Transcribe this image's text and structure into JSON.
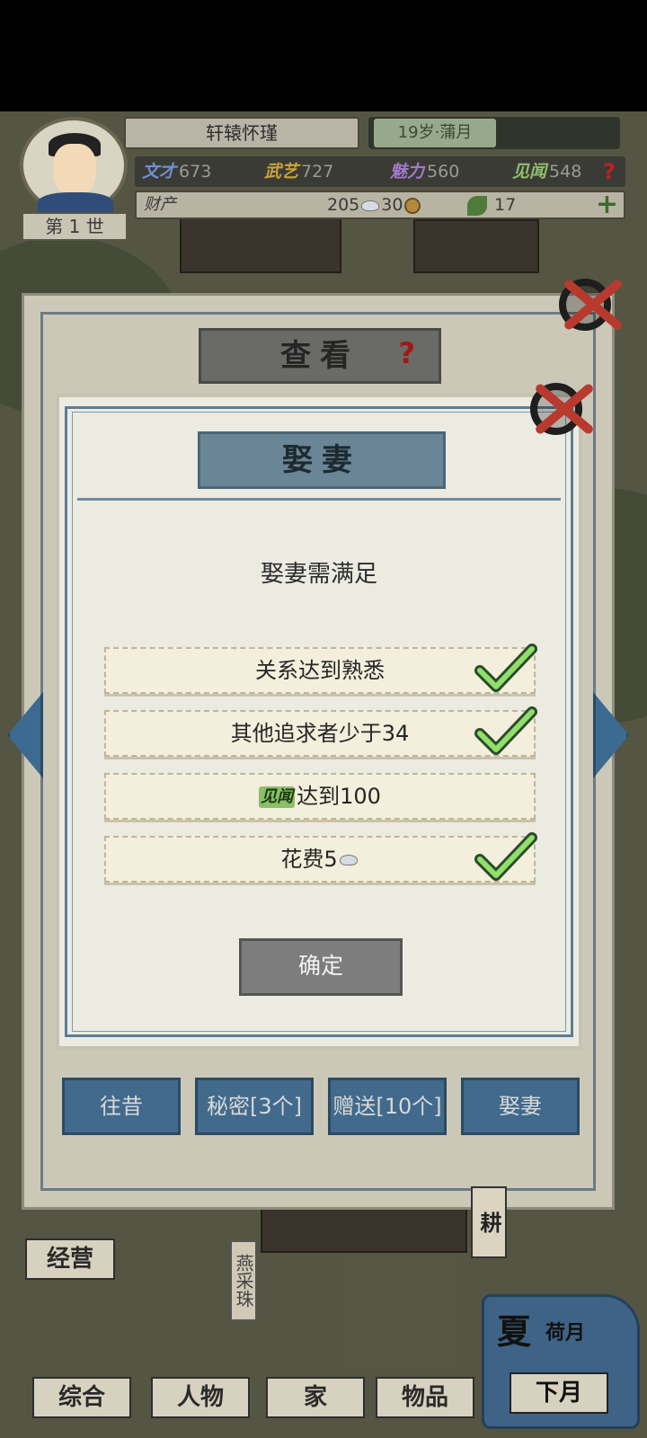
{
  "header": {
    "player_name": "轩辕怀瑾",
    "age_month": "19岁·蒲月",
    "generation": "第 1 世",
    "stats": [
      {
        "label": "文才",
        "value": "673",
        "color": "#6f8fd0"
      },
      {
        "label": "武艺",
        "value": "727",
        "color": "#c9a63a"
      },
      {
        "label": "魅力",
        "value": "560",
        "color": "#a07ac8"
      },
      {
        "label": "见闻",
        "value": "548",
        "color": "#8fbf6a"
      }
    ],
    "wealth_label": "财产",
    "silver": "205",
    "copper": "30",
    "farmland": "17",
    "icons": {
      "help": "question-icon",
      "add": "plus-icon",
      "silver": "silver-ingot-icon",
      "copper": "copper-coin-icon",
      "land": "leaf-icon"
    }
  },
  "outer_panel": {
    "title": "查看",
    "help_glyph": "?",
    "tabs": [
      "往昔",
      "秘密[3个]",
      "赠送[10个]",
      "娶妻"
    ]
  },
  "dialog": {
    "title": "娶妻",
    "heading": "娶妻需满足",
    "requirements": [
      {
        "text": "关系达到熟悉",
        "met": true
      },
      {
        "text": "其他追求者少于34",
        "met": true
      },
      {
        "tag": "见闻",
        "text": "达到100",
        "met": false
      },
      {
        "text": "花费5",
        "met": true,
        "icon": "silver-ingot-icon"
      }
    ],
    "confirm_label": "确定"
  },
  "bottom_menu": {
    "items": [
      "经营",
      "综合",
      "人物",
      "家",
      "物品"
    ],
    "npc_name": "燕采珠",
    "side_label": "耕",
    "season": "夏",
    "month": "荷月",
    "next_label": "下月"
  }
}
